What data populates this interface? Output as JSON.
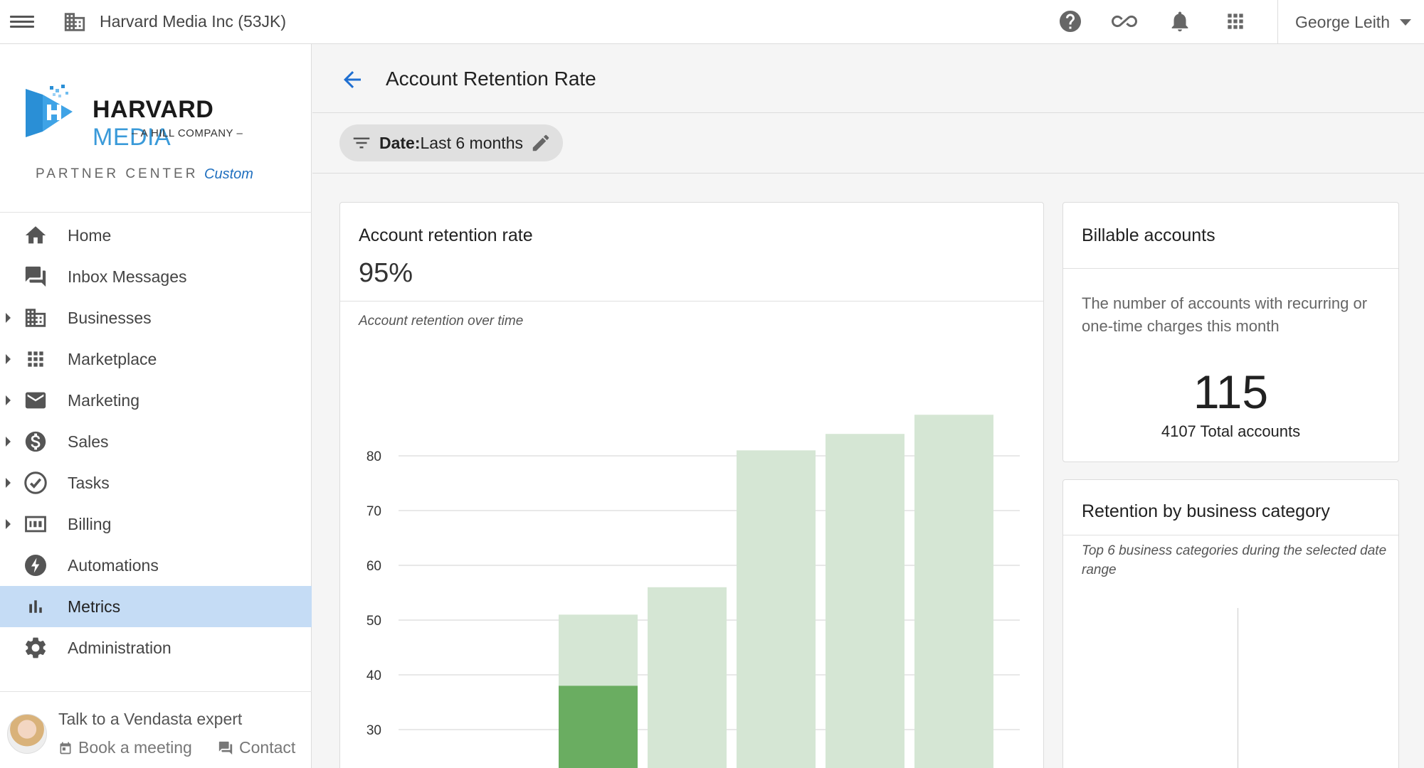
{
  "topbar": {
    "org_name": "Harvard Media Inc (53JK)",
    "user_name": "George Leith",
    "icons": [
      "help-icon",
      "infinity-icon",
      "bell-icon",
      "apps-grid-icon"
    ]
  },
  "sidebar": {
    "brand_name_a": "HARVARD",
    "brand_name_b": "MEDIA",
    "brand_tagline": "– A HILL COMPANY –",
    "partner_center": "PARTNER CENTER",
    "custom_label": "Custom",
    "items": [
      {
        "label": "Home",
        "icon": "home-icon",
        "expandable": false
      },
      {
        "label": "Inbox Messages",
        "icon": "chat-icon",
        "expandable": false
      },
      {
        "label": "Businesses",
        "icon": "building-icon",
        "expandable": true
      },
      {
        "label": "Marketplace",
        "icon": "grid-icon",
        "expandable": true
      },
      {
        "label": "Marketing",
        "icon": "mail-icon",
        "expandable": true
      },
      {
        "label": "Sales",
        "icon": "dollar-icon",
        "expandable": true
      },
      {
        "label": "Tasks",
        "icon": "check-circle-icon",
        "expandable": true
      },
      {
        "label": "Billing",
        "icon": "billing-icon",
        "expandable": true
      },
      {
        "label": "Automations",
        "icon": "bolt-icon",
        "expandable": false
      },
      {
        "label": "Metrics",
        "icon": "bar-chart-icon",
        "expandable": false,
        "active": true
      },
      {
        "label": "Administration",
        "icon": "gear-icon",
        "expandable": false
      }
    ],
    "expert": {
      "title": "Talk to a Vendasta expert",
      "book_label": "Book a meeting",
      "contact_label": "Contact"
    }
  },
  "page": {
    "title": "Account Retention Rate",
    "filter_key": "Date:",
    "filter_value": "Last 6 months"
  },
  "retention_card": {
    "title": "Account retention rate",
    "value": "95%",
    "subtitle": "Account retention over time"
  },
  "billable_card": {
    "title": "Billable accounts",
    "description": "The number of accounts with recurring or one-time charges this month",
    "count": "115",
    "total": "4107 Total accounts"
  },
  "category_card": {
    "title": "Retention by business category",
    "subtitle": "Top 6 business categories during the selected date range"
  },
  "chart_data": {
    "type": "bar",
    "ylim": [
      27,
      95
    ],
    "yticks": [
      30,
      40,
      50,
      60,
      70,
      80
    ],
    "grid": true,
    "series": [
      {
        "values": [
          null,
          null,
          51,
          56,
          81,
          84,
          87.5
        ]
      },
      {
        "values": [
          null,
          null,
          38,
          null,
          null,
          null,
          null
        ]
      }
    ],
    "colors": {
      "light": "#d5e6d4",
      "dark": "#6aad61",
      "grid": "#e0e0e0"
    }
  }
}
